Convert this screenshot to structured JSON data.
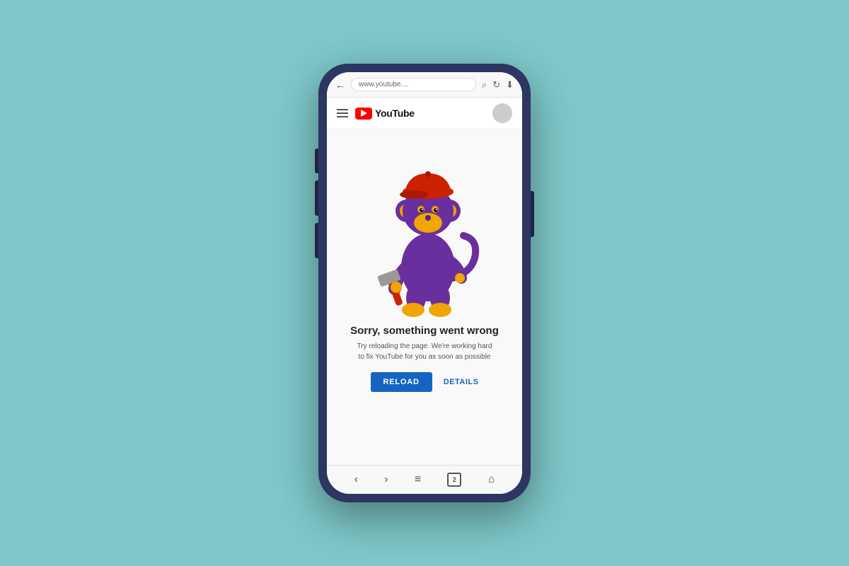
{
  "background_color": "#7ec8c8",
  "phone": {
    "browser": {
      "url": "www.youtube....",
      "back_icon": "←",
      "search_icon": "⌕",
      "refresh_icon": "↻",
      "download_icon": "⬇"
    },
    "youtube_header": {
      "menu_label": "menu",
      "wordmark": "YouTube",
      "avatar_label": "user avatar"
    },
    "error_page": {
      "title": "Sorry, something went wrong",
      "subtitle": "Try reloading the page. We're working hard to fix YouTube for you as soon as possible",
      "reload_button": "RELOAD",
      "details_button": "DETAILS"
    },
    "nav_bar": {
      "back": "‹",
      "forward": "›",
      "menu": "≡",
      "tabs": "2",
      "home": "⌂"
    }
  }
}
